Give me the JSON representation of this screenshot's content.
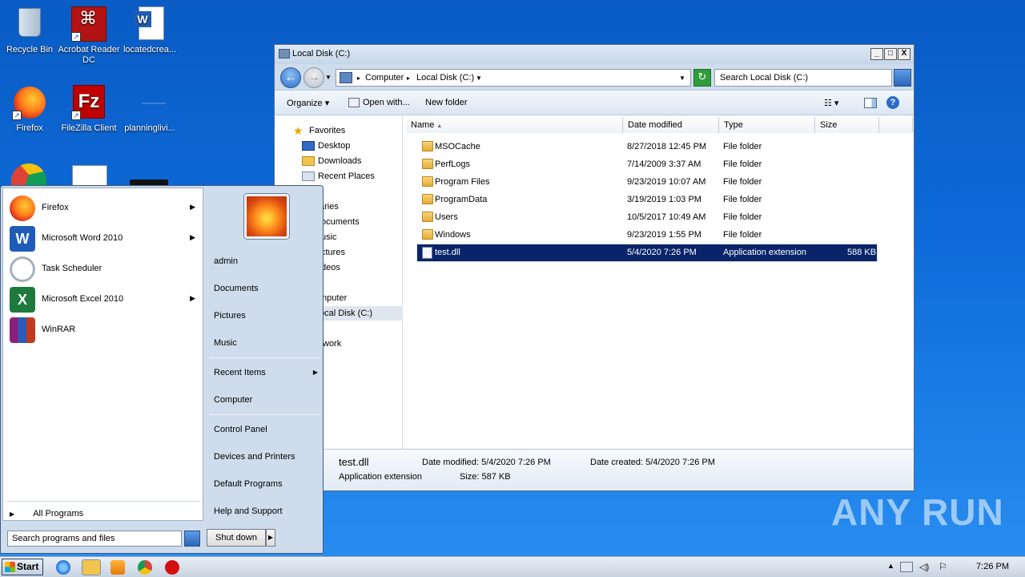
{
  "desktop": {
    "icons": [
      {
        "label": "Recycle Bin",
        "icon": "recycle-bin-icon"
      },
      {
        "label": "Acrobat Reader DC",
        "icon": "acrobat-icon"
      },
      {
        "label": "locatedcrea...",
        "icon": "word-document-icon"
      },
      {
        "label": "Firefox",
        "icon": "firefox-icon"
      },
      {
        "label": "FileZilla Client",
        "icon": "filezilla-icon"
      },
      {
        "label": "planninglivi...",
        "icon": "file-icon"
      }
    ]
  },
  "explorer": {
    "title": "Local Disk (C:)",
    "window_buttons": {
      "minimize": "_",
      "maximize": "□",
      "close": "X"
    },
    "breadcrumb": [
      "Computer",
      "Local Disk (C:)"
    ],
    "search_placeholder": "Search Local Disk (C:)",
    "toolbar": {
      "organize": "Organize",
      "open_with": "Open with...",
      "new_folder": "New folder"
    },
    "nav": {
      "favorites": "Favorites",
      "items": [
        "Desktop",
        "Downloads",
        "Recent Places"
      ],
      "libraries_partial": [
        "aries",
        "ocuments",
        "usic",
        "ctures",
        "deos"
      ],
      "computer_partial": "mputer",
      "local_disk_partial": "ocal Disk (C:)",
      "network_partial": "work"
    },
    "columns": {
      "name": "Name",
      "date": "Date modified",
      "type": "Type",
      "size": "Size"
    },
    "files": [
      {
        "name": "MSOCache",
        "date": "8/27/2018 12:45 PM",
        "type": "File folder",
        "size": ""
      },
      {
        "name": "PerfLogs",
        "date": "7/14/2009 3:37 AM",
        "type": "File folder",
        "size": ""
      },
      {
        "name": "Program Files",
        "date": "9/23/2019 10:07 AM",
        "type": "File folder",
        "size": ""
      },
      {
        "name": "ProgramData",
        "date": "3/19/2019 1:03 PM",
        "type": "File folder",
        "size": ""
      },
      {
        "name": "Users",
        "date": "10/5/2017 10:49 AM",
        "type": "File folder",
        "size": ""
      },
      {
        "name": "Windows",
        "date": "9/23/2019 1:55 PM",
        "type": "File folder",
        "size": ""
      },
      {
        "name": "test.dll",
        "date": "5/4/2020 7:26 PM",
        "type": "Application extension",
        "size": "588 KB"
      }
    ],
    "details": {
      "name": "test.dll",
      "modified": "Date modified: 5/4/2020 7:26 PM",
      "created": "Date created: 5/4/2020 7:26 PM",
      "type": "Application extension",
      "size": "Size: 587 KB"
    }
  },
  "startmenu": {
    "programs": [
      {
        "label": "Firefox",
        "has_arrow": true
      },
      {
        "label": "Microsoft Word 2010",
        "has_arrow": true
      },
      {
        "label": "Task Scheduler",
        "has_arrow": false
      },
      {
        "label": "Microsoft Excel 2010",
        "has_arrow": true
      },
      {
        "label": "WinRAR",
        "has_arrow": false
      }
    ],
    "all_programs": "All Programs",
    "search_placeholder": "Search programs and files",
    "right": [
      "admin",
      "Documents",
      "Pictures",
      "Music",
      "Recent Items",
      "Computer",
      "Control Panel",
      "Devices and Printers",
      "Default Programs",
      "Help and Support"
    ],
    "shutdown": "Shut down"
  },
  "taskbar": {
    "start": "Start",
    "clock": "7:26 PM"
  },
  "watermark": "ANY RUN"
}
